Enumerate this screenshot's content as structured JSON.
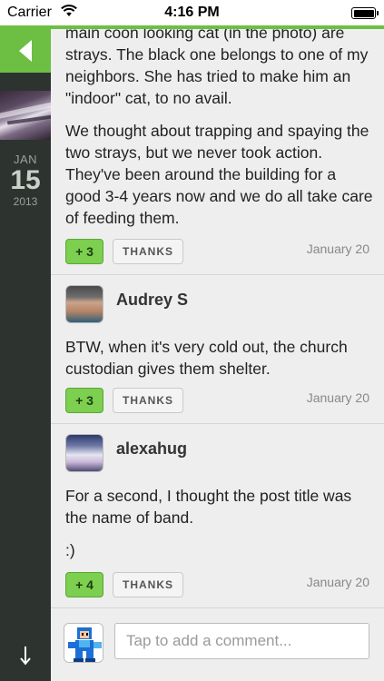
{
  "status_bar": {
    "carrier": "Carrier",
    "time": "4:16 PM"
  },
  "rail": {
    "month": "JAN",
    "day": "15",
    "year": "2013"
  },
  "first_comment": {
    "paragraphs": [
      "main coon looking cat (in the photo) are strays. The black one belongs to one of my neighbors. She has tried to make him an \"indoor\" cat, to no avail.",
      "We thought about trapping and spaying the two strays, but we never took action. They've been around the building for a good 3-4 years now and we do all take care of feeding them."
    ],
    "votes": "+ 3",
    "thanks": "THANKS",
    "date": "January 20"
  },
  "comments": [
    {
      "author": "Audrey S",
      "paragraphs": [
        "BTW, when it's very cold out, the church custodian gives them shelter."
      ],
      "votes": "+ 3",
      "thanks": "THANKS",
      "date": "January 20"
    },
    {
      "author": "alexahug",
      "paragraphs": [
        "For a second, I thought the post title was the name of band.",
        ":)"
      ],
      "votes": "+ 4",
      "thanks": "THANKS",
      "date": "January 20"
    }
  ],
  "composer": {
    "placeholder": "Tap to add a comment..."
  },
  "colors": {
    "accent_green": "#6cbf43",
    "vote_green": "#7ccf4f",
    "rail_dark": "#2d332f",
    "content_bg": "#eeeeee"
  },
  "icons": {
    "back": "back-arrow-icon",
    "wifi": "wifi-icon",
    "battery": "battery-icon",
    "scroll_down": "down-arrow-icon"
  }
}
